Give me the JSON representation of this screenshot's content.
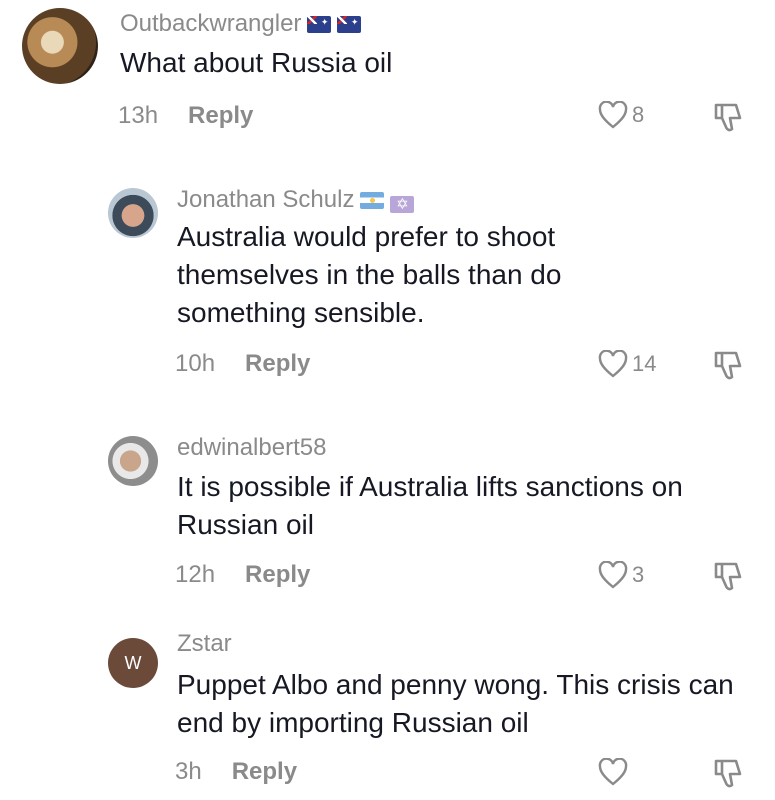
{
  "comments": [
    {
      "username": "Outbackwrangler",
      "text": "What about Russia oil",
      "time": "13h",
      "reply": "Reply",
      "likes": "8"
    },
    {
      "username": "Jonathan Schulz",
      "text": "Australia would prefer to shoot themselves in the balls than do something sensible.",
      "time": "10h",
      "reply": "Reply",
      "likes": "14"
    },
    {
      "username": "edwinalbert58",
      "text": "It is possible if Australia lifts sanctions on Russian oil",
      "time": "12h",
      "reply": "Reply",
      "likes": "3"
    },
    {
      "username": "Zstar",
      "avatar_letter": "W",
      "text": "Puppet Albo and penny wong. This crisis can end by importing Russian oil",
      "time": "3h",
      "reply": "Reply",
      "likes": ""
    }
  ],
  "icons": {
    "like": "heart-outline-icon",
    "dislike": "thumbs-down-icon"
  },
  "colors": {
    "muted": "#8a8a8a",
    "text": "#161823",
    "avatar_w": "#6b4a3a"
  }
}
